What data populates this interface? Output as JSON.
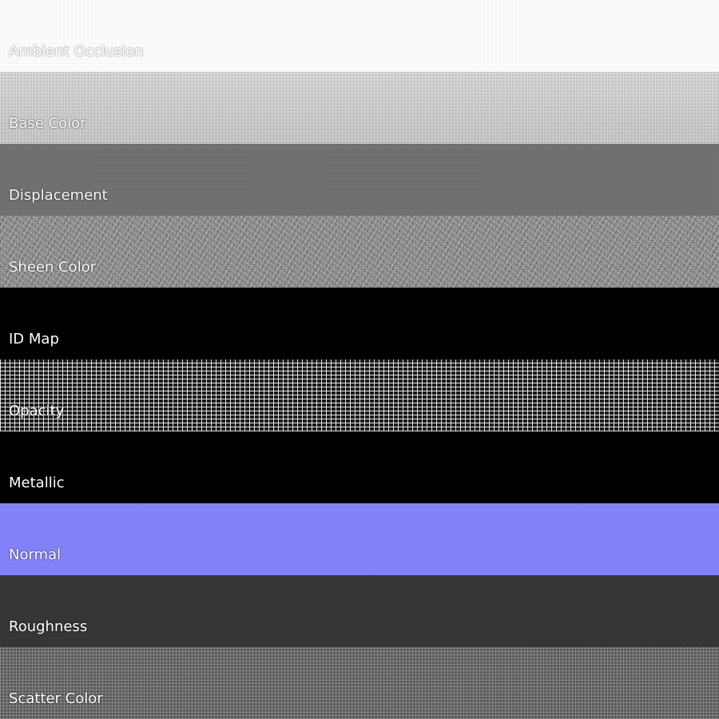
{
  "bands": [
    {
      "label": "Ambient Occlusion",
      "texture": "ambient-occlusion",
      "color": "#fbfbfb"
    },
    {
      "label": "Base Color",
      "texture": "base-color",
      "color": "#c8c8c8"
    },
    {
      "label": "Displacement",
      "texture": "displacement",
      "color": "#6f6f6f"
    },
    {
      "label": "Sheen Color",
      "texture": "sheen-color",
      "color": "#8a8a8a"
    },
    {
      "label": "ID Map",
      "texture": "id-map",
      "color": "#000000"
    },
    {
      "label": "Opacity",
      "texture": "opacity",
      "color": "#1a1a1a"
    },
    {
      "label": "Metallic",
      "texture": "metallic",
      "color": "#000000"
    },
    {
      "label": "Normal",
      "texture": "normal",
      "color": "#8282f6"
    },
    {
      "label": "Roughness",
      "texture": "roughness",
      "color": "#353535"
    },
    {
      "label": "Scatter Color",
      "texture": "scatter-color",
      "color": "#5a5a5a"
    }
  ]
}
